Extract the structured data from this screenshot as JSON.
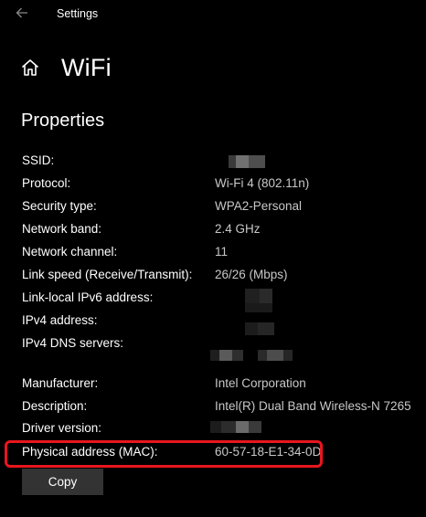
{
  "window": {
    "app_title": "Settings"
  },
  "header": {
    "title": "WiFi"
  },
  "section": {
    "title": "Properties"
  },
  "properties": {
    "ssid": {
      "label": "SSID:",
      "value": ""
    },
    "protocol": {
      "label": "Protocol:",
      "value": "Wi-Fi 4 (802.11n)"
    },
    "security_type": {
      "label": "Security type:",
      "value": "WPA2-Personal"
    },
    "network_band": {
      "label": "Network band:",
      "value": "2.4 GHz"
    },
    "network_channel": {
      "label": "Network channel:",
      "value": "11"
    },
    "link_speed": {
      "label": "Link speed (Receive/Transmit):",
      "value": "26/26 (Mbps)"
    },
    "ipv6": {
      "label": "Link-local IPv6 address:",
      "value": ""
    },
    "ipv4": {
      "label": "IPv4 address:",
      "value": ""
    },
    "dns": {
      "label": "IPv4 DNS servers:",
      "value": ""
    },
    "manufacturer": {
      "label": "Manufacturer:",
      "value": "Intel Corporation"
    },
    "description": {
      "label": "Description:",
      "value": "Intel(R) Dual Band Wireless-N 7265"
    },
    "driver_version": {
      "label": "Driver version:",
      "value": ""
    },
    "mac": {
      "label": "Physical address (MAC):",
      "value": "60-57-18-E1-34-0D"
    }
  },
  "actions": {
    "copy_label": "Copy"
  },
  "colors": {
    "background": "#000000",
    "text": "#ffffff",
    "value_text": "#c8c8c8",
    "highlight": "#e8161e",
    "button": "#333333"
  }
}
